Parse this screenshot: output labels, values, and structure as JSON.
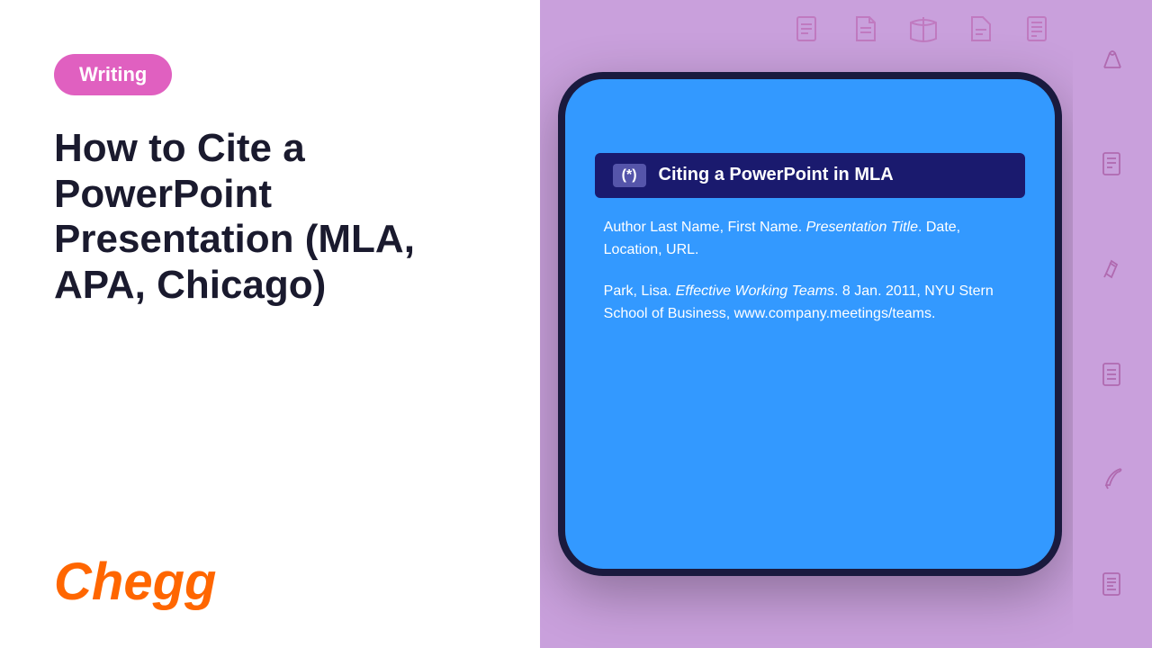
{
  "badge": {
    "label": "Writing"
  },
  "article": {
    "title": "How to Cite a PowerPoint Presentation (MLA, APA, Chicago)"
  },
  "logo": {
    "text": "Chegg"
  },
  "slide": {
    "header_badge": "(*)",
    "header_title": "Citing a PowerPoint in MLA",
    "format_line": "Author Last Name, First Name. Presentation Title. Date, Location, URL.",
    "example_line1": "Park, Lisa. Effective Working Teams. 8 Jan. 2011, NYU Stern",
    "example_line2": "School of Business, www.company.meetings/teams."
  },
  "icons": [
    "document-lines",
    "document-corner",
    "open-book",
    "document-fold",
    "document-list",
    "pen-nib",
    "document-lines-2",
    "document-paragraph",
    "pen-writing",
    "document-lines-3",
    "pen-nib-2",
    "document-lines-4"
  ]
}
